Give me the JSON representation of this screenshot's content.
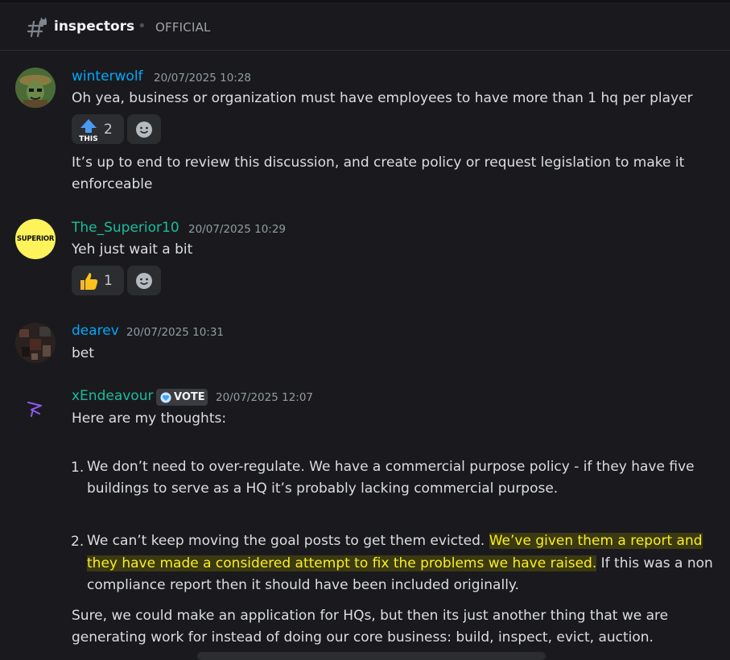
{
  "channel": {
    "name": "inspectors",
    "topic": "OFFICIAL"
  },
  "messages": [
    {
      "author": "winterwolf",
      "author_color": "#00a8fc",
      "timestamp": "20/07/2025 10:28",
      "lines": [
        "Oh yea, business or organization must have employees to have more than 1 hq per player"
      ],
      "reaction": {
        "emoji": "this-arrow-icon",
        "emoji_text": "THIS",
        "count": "2"
      },
      "followup_lines": [
        "It’s up to end to review this discussion, and create policy or request legislation to make it",
        "enforceable"
      ]
    },
    {
      "author": "The_Superior10",
      "author_color": "#1abc9c",
      "avatar_text": "SUPERIOR",
      "timestamp": "20/07/2025 10:29",
      "lines": [
        "Yeh just wait a bit"
      ],
      "reaction": {
        "emoji": "thumbs-up-icon",
        "count": "1"
      }
    },
    {
      "author": "dearev",
      "author_color": "#00a8fc",
      "timestamp": "20/07/2025 10:31",
      "lines": [
        "bet"
      ]
    },
    {
      "author": "xEndeavour",
      "author_color": "#1abc9c",
      "badge": "VOTE",
      "timestamp": "20/07/2025 12:07",
      "intro": "Here are my thoughts:",
      "list": [
        {
          "num": "1.",
          "line1": "We don’t need to over-regulate.  We have a commercial purpose policy - if they have five",
          "line2": "buildings to serve as a HQ it’s probably lacking commercial purpose."
        },
        {
          "num": "2.",
          "line1_plain": "We can’t keep moving the goal posts to get them evicted. ",
          "line1_highlight": "We’ve given them a report and",
          "line2_highlight": "they have made a considered attempt to fix the problems we have raised.",
          "line2_plain": " If this was a non",
          "line3": "compliance report then it should have been included originally."
        }
      ],
      "outro_lines": [
        "Sure, we could make an application for HQs, but then its just another thing that we are",
        "generating work for instead of doing our core business: build, inspect, evict, auction."
      ]
    }
  ],
  "colors": {
    "background": "#1a1a1e",
    "highlight_text": "#fcee21",
    "highlight_bg": "#3b3a12"
  }
}
